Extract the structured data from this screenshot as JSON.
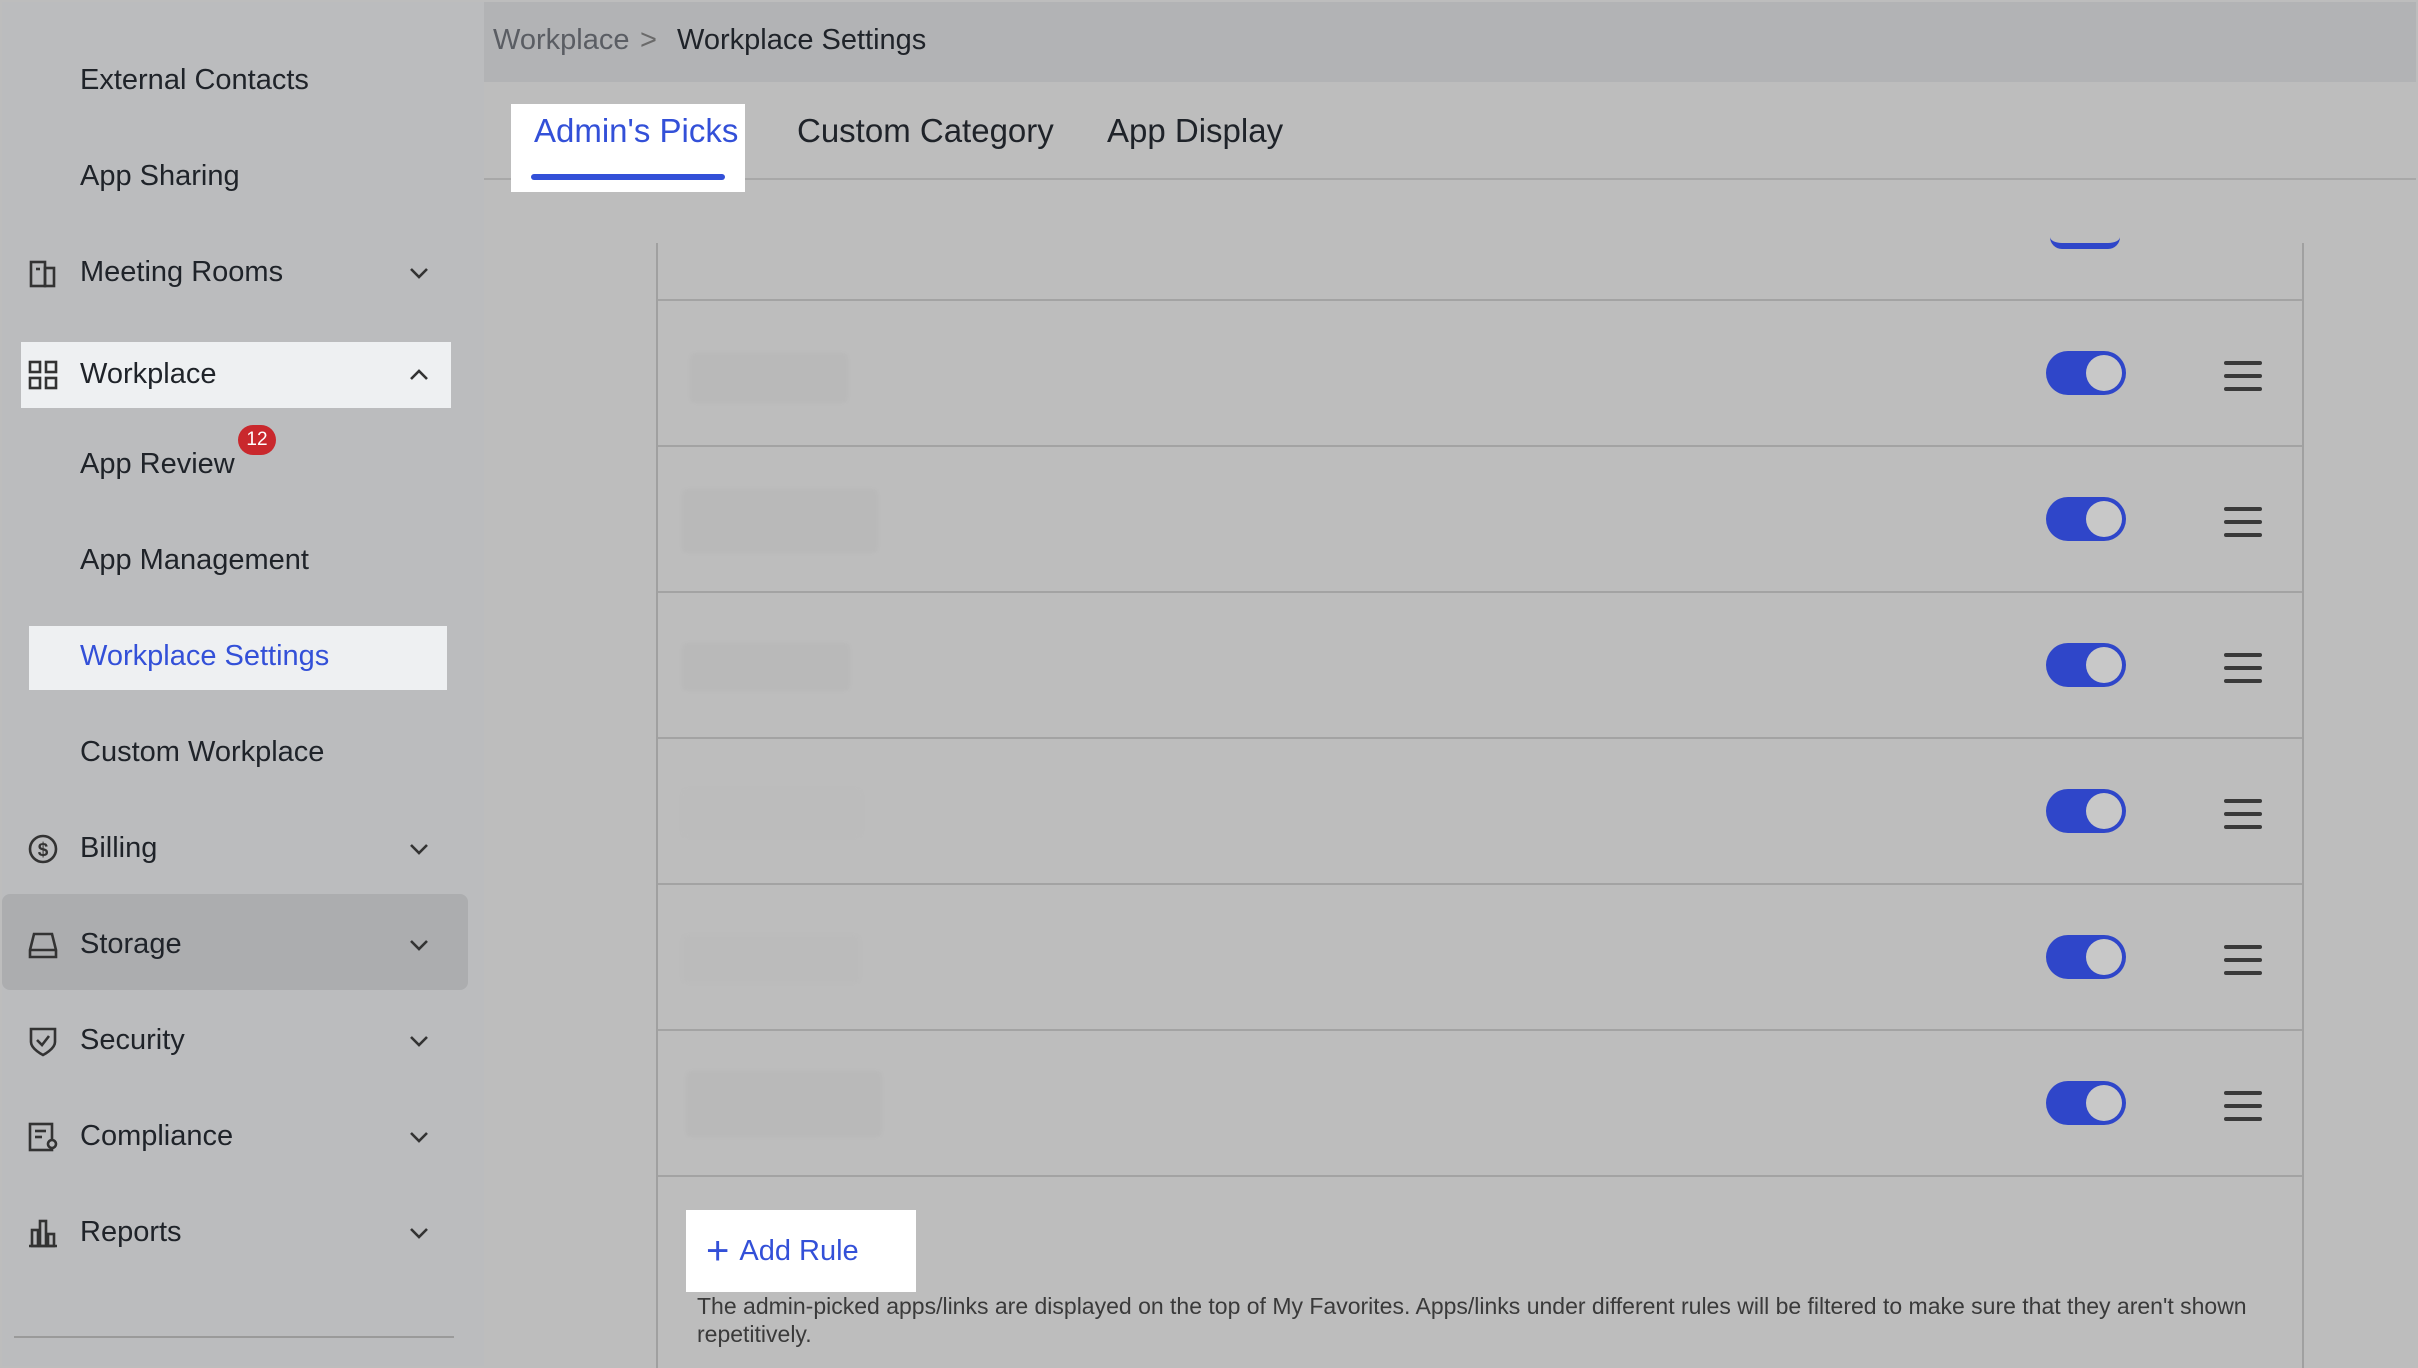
{
  "sidebar": {
    "items": [
      {
        "label": "External Contacts"
      },
      {
        "label": "App Sharing"
      },
      {
        "label": "Meeting Rooms"
      },
      {
        "label": "Workplace"
      },
      {
        "label": "App Review",
        "badge": "12"
      },
      {
        "label": "App Management"
      },
      {
        "label": "Workplace Settings"
      },
      {
        "label": "Custom Workplace"
      },
      {
        "label": "Billing"
      },
      {
        "label": "Storage"
      },
      {
        "label": "Security"
      },
      {
        "label": "Compliance"
      },
      {
        "label": "Reports"
      }
    ]
  },
  "breadcrumb": {
    "parent": "Workplace",
    "separator": ">",
    "current": "Workplace Settings"
  },
  "tabs": [
    {
      "label": "Admin's Picks",
      "active": true
    },
    {
      "label": "Custom Category"
    },
    {
      "label": "App Display"
    }
  ],
  "rules": {
    "rows": [
      {
        "enabled": true
      },
      {
        "enabled": true
      },
      {
        "enabled": true
      },
      {
        "enabled": true
      },
      {
        "enabled": true
      },
      {
        "enabled": true
      }
    ],
    "add_rule_label": "Add Rule",
    "hint": "The admin-picked apps/links are displayed on the top of My Favorites. Apps/links under different rules will be filtered to make sure that they aren't shown repetitively."
  },
  "colors": {
    "accent": "#3350d8",
    "toggle_on": "#2f46c9",
    "badge": "#c9282d"
  }
}
